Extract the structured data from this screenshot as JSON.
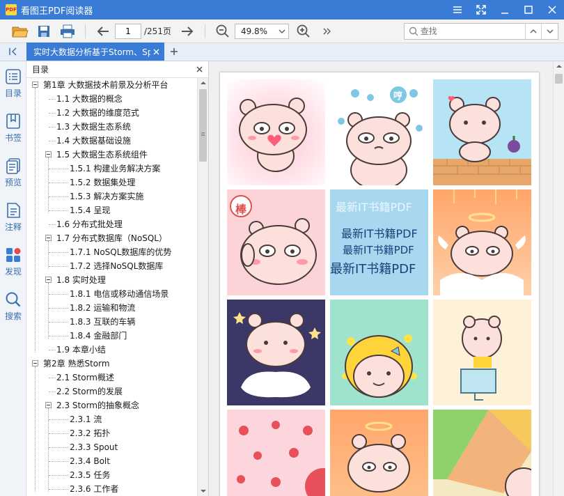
{
  "app": {
    "title": "看图王PDF阅读器",
    "logo_text": "PDF"
  },
  "toolbar": {
    "current_page": "1",
    "total_pages": "/251页",
    "zoom": "49.8%",
    "search_placeholder": "查找"
  },
  "tab": {
    "label": "实时大数据分析基于Storm、Sp"
  },
  "rail": {
    "items": [
      {
        "label": "目录",
        "icon": "list-icon"
      },
      {
        "label": "书签",
        "icon": "bookmark-icon"
      },
      {
        "label": "预览",
        "icon": "preview-icon"
      },
      {
        "label": "注释",
        "icon": "annotation-icon"
      },
      {
        "label": "发现",
        "icon": "discover-icon"
      },
      {
        "label": "搜索",
        "icon": "search-icon"
      }
    ]
  },
  "toc": {
    "header": "目录",
    "items": [
      {
        "label": "第1章  大数据技术前景及分析平台",
        "level": 0
      },
      {
        "label": "1.1  大数据的概念",
        "level": 1
      },
      {
        "label": "1.2  大数据的维度范式",
        "level": 1
      },
      {
        "label": "1.3  大数据生态系统",
        "level": 1
      },
      {
        "label": "1.4  大数据基础设施",
        "level": 1
      },
      {
        "label": "1.5  大数据生态系统组件",
        "level": 1,
        "expanded": true
      },
      {
        "label": "1.5.1  构建业务解决方案",
        "level": 2
      },
      {
        "label": "1.5.2  数据集处理",
        "level": 2
      },
      {
        "label": "1.5.3  解决方案实施",
        "level": 2
      },
      {
        "label": "1.5.4  呈现",
        "level": 2
      },
      {
        "label": "1.6  分布式批处理",
        "level": 1
      },
      {
        "label": "1.7  分布式数据库（NoSQL）",
        "level": 1,
        "expanded": true
      },
      {
        "label": "1.7.1  NoSQL数据库的优势",
        "level": 2
      },
      {
        "label": "1.7.2  选择NoSQL数据库",
        "level": 2
      },
      {
        "label": "1.8  实时处理",
        "level": 1,
        "expanded": true
      },
      {
        "label": "1.8.1  电信或移动通信场景",
        "level": 2
      },
      {
        "label": "1.8.2  运输和物流",
        "level": 2
      },
      {
        "label": "1.8.3  互联的车辆",
        "level": 2
      },
      {
        "label": "1.8.4  金融部门",
        "level": 2
      },
      {
        "label": "1.9  本章小结",
        "level": 1
      },
      {
        "label": "第2章  熟悉Storm",
        "level": 0
      },
      {
        "label": "2.1  Storm概述",
        "level": 1
      },
      {
        "label": "2.2  Storm的发展",
        "level": 1
      },
      {
        "label": "2.3  Storm的抽象概念",
        "level": 1,
        "expanded": true
      },
      {
        "label": "2.3.1  流",
        "level": 2
      },
      {
        "label": "2.3.2  拓扑",
        "level": 2
      },
      {
        "label": "2.3.3  Spout",
        "level": 2
      },
      {
        "label": "2.3.4  Bolt",
        "level": 2
      },
      {
        "label": "2.3.5  任务",
        "level": 2
      },
      {
        "label": "2.3.6  工作者",
        "level": 2
      }
    ]
  },
  "page_content": {
    "stamp_text": "棒",
    "bubble_text": "哼",
    "watermark_lines": [
      "最新IT书籍PDF",
      "最新IT书籍PDF",
      "最新IT书籍PDF",
      "最新IT书籍PDF"
    ]
  },
  "colors": {
    "accent": "#3a7bd5",
    "rail_text": "#3a6fb0"
  }
}
